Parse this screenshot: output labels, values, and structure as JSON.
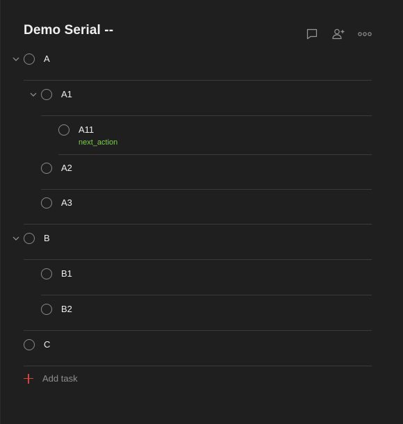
{
  "project": {
    "title": "Demo Serial --"
  },
  "toolbar": {
    "icons": [
      "comment-icon",
      "share-user-icon",
      "more-icon"
    ]
  },
  "tasks": [
    {
      "id": "A",
      "label": "A",
      "level": 0,
      "collapsible": true
    },
    {
      "id": "A1",
      "label": "A1",
      "level": 1,
      "collapsible": true
    },
    {
      "id": "A11",
      "label": "A11",
      "level": 2,
      "collapsible": false,
      "label_tag": "next_action"
    },
    {
      "id": "A2",
      "label": "A2",
      "level": 1,
      "collapsible": false
    },
    {
      "id": "A3",
      "label": "A3",
      "level": 1,
      "collapsible": false
    },
    {
      "id": "B",
      "label": "B",
      "level": 0,
      "collapsible": true
    },
    {
      "id": "B1",
      "label": "B1",
      "level": 1,
      "collapsible": false
    },
    {
      "id": "B2",
      "label": "B2",
      "level": 1,
      "collapsible": false
    },
    {
      "id": "C",
      "label": "C",
      "level": 0,
      "collapsible": false
    }
  ],
  "add_task": {
    "label": "Add task"
  },
  "colors": {
    "background": "#1f1f1f",
    "tag": "#7ecc49",
    "add_icon": "#d1453b"
  }
}
